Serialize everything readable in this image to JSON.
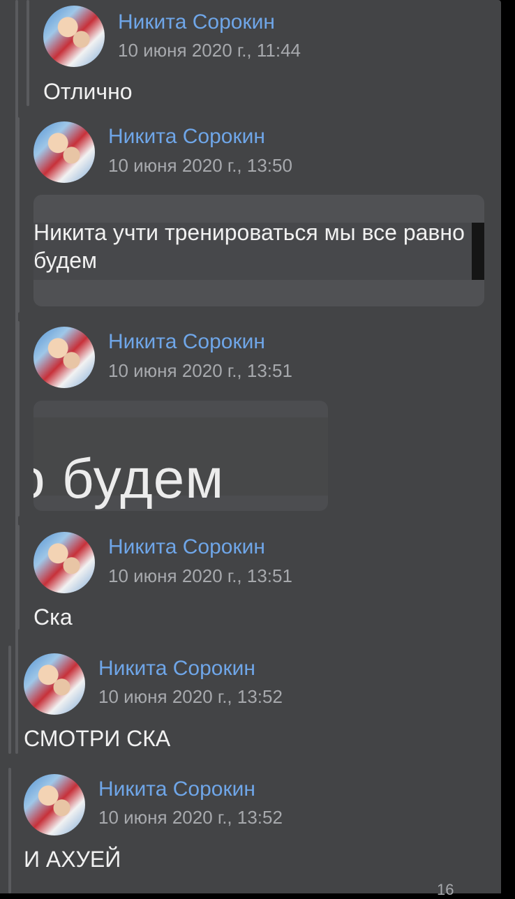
{
  "messages": [
    {
      "author": "Никита Сорокин",
      "time": "10 июня 2020 г., 11:44",
      "text": "Отлично"
    },
    {
      "author": "Никита Сорокин",
      "time": "10 июня 2020 г., 13:50",
      "quote": "Никита учти тренироваться мы все равно будем"
    },
    {
      "author": "Никита Сорокин",
      "time": "10 июня 2020 г., 13:51",
      "image_text": "о будем"
    },
    {
      "author": "Никита Сорокин",
      "time": "10 июня 2020 г., 13:51",
      "text": "Ска"
    },
    {
      "author": "Никита Сорокин",
      "time": "10 июня 2020 г., 13:52",
      "text": "СМОТРИ СКА"
    },
    {
      "author": "Никита Сорокин",
      "time": "10 июня 2020 г., 13:52",
      "text": "И АХУЕЙ"
    }
  ],
  "bottom_counter": "16",
  "colors": {
    "panel": "#434446",
    "author": "#6fa6e8",
    "time": "#a7a9ad",
    "text": "#f1f1f1"
  }
}
